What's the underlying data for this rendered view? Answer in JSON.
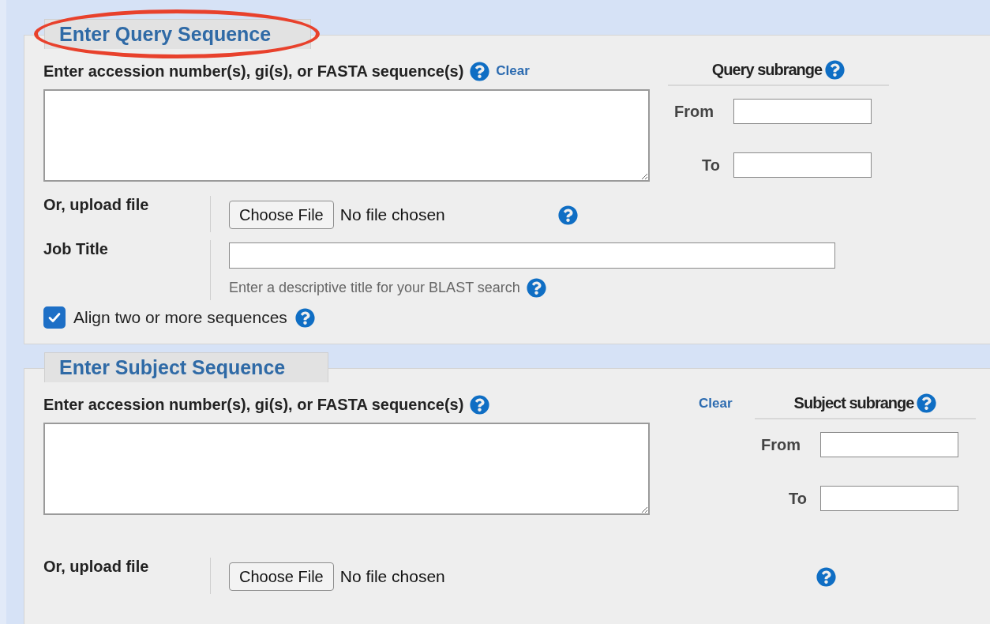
{
  "query": {
    "title": "Enter Query Sequence",
    "highlighted": true,
    "input_label": "Enter accession number(s), gi(s), or FASTA sequence(s)",
    "clear": "Clear",
    "subrange": {
      "title": "Query subrange",
      "from_label": "From",
      "to_label": "To"
    },
    "upload": {
      "label": "Or, upload file",
      "button": "Choose File",
      "status": "No file chosen"
    },
    "job_title": {
      "label": "Job Title",
      "hint": "Enter a descriptive title for your BLAST search"
    },
    "align": {
      "label": "Align two or more sequences",
      "checked": true
    }
  },
  "subject": {
    "title": "Enter Subject Sequence",
    "highlighted": false,
    "input_label": "Enter accession number(s), gi(s), or FASTA sequence(s)",
    "clear": "Clear",
    "subrange": {
      "title": "Subject subrange",
      "from_label": "From",
      "to_label": "To"
    },
    "upload": {
      "label": "Or, upload file",
      "button": "Choose File",
      "status": "No file chosen"
    }
  }
}
